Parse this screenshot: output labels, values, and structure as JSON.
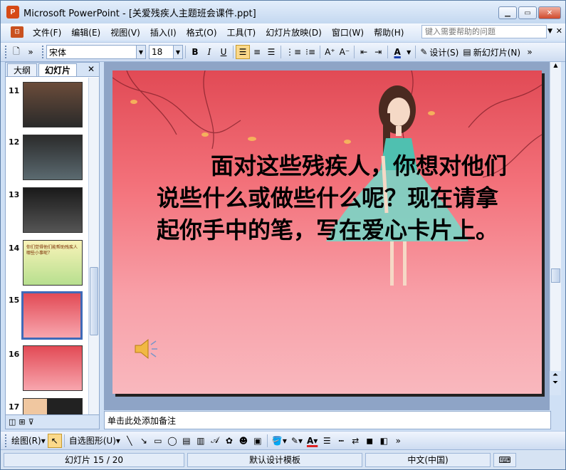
{
  "window": {
    "title": "Microsoft PowerPoint - [关爱残疾人主题班会课件.ppt]",
    "app_icon": "powerpoint-icon"
  },
  "menu": {
    "items": [
      "文件(F)",
      "编辑(E)",
      "视图(V)",
      "插入(I)",
      "格式(O)",
      "工具(T)",
      "幻灯片放映(D)",
      "窗口(W)",
      "帮助(H)"
    ],
    "help_placeholder": "键入需要帮助的问题"
  },
  "toolbar": {
    "font_name": "宋体",
    "font_size": "18",
    "bold": "B",
    "italic": "I",
    "underline": "U",
    "design_label": "设计(S)",
    "new_slide_label": "新幻灯片(N)"
  },
  "left_panel": {
    "tab_outline": "大纲",
    "tab_slides": "幻灯片",
    "thumbnails": [
      {
        "num": "11",
        "caption": ""
      },
      {
        "num": "12",
        "caption": ""
      },
      {
        "num": "13",
        "caption": ""
      },
      {
        "num": "14",
        "caption": "你们觉得他们能帮助残疾人哪些小事呢？"
      },
      {
        "num": "15",
        "caption": ""
      },
      {
        "num": "16",
        "caption": ""
      },
      {
        "num": "17",
        "caption": ""
      }
    ],
    "selected": "15"
  },
  "slide": {
    "text": "面对这些残疾人，你想对他们说些什么或做些什么呢？现在请拿起你手中的笔，写在爱心卡片上。"
  },
  "notes": {
    "placeholder": "单击此处添加备注"
  },
  "drawing": {
    "draw_label": "绘图(R)",
    "autoshape_label": "自选图形(U)"
  },
  "status": {
    "slide_pos": "幻灯片 15 / 20",
    "template": "默认设计模板",
    "language": "中文(中国)"
  },
  "colors": {
    "accent": "#fbd98a",
    "slide_top": "#e14a55",
    "slide_bottom": "#f9b8be"
  }
}
